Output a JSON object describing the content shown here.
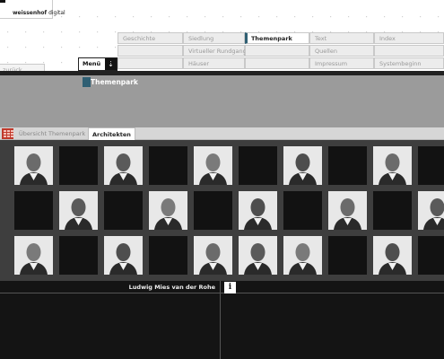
{
  "logo": {
    "prefix": "weissenhof",
    "suffix": " digital"
  },
  "nav": {
    "rows": [
      [
        "Geschichte",
        "Siedlung",
        "Themenpark",
        "Text",
        "Index"
      ],
      [
        "",
        "Virtueller Rundgang",
        "",
        "Quellen",
        ""
      ],
      [
        "",
        "Häuser",
        "",
        "Impressum",
        "Systembeginn"
      ]
    ],
    "active": "Themenpark"
  },
  "back_label": "zurück",
  "menu_label": "Menü",
  "menu_arrow": "⇣",
  "banner_title": "Themenpark",
  "tabs": {
    "overview": "Übersicht Themenpark",
    "current": "Architekten"
  },
  "architect_grid": [
    [
      1,
      0,
      1,
      0,
      1,
      0,
      1,
      0,
      1,
      0
    ],
    [
      0,
      1,
      0,
      1,
      0,
      1,
      0,
      1,
      0,
      1
    ],
    [
      1,
      0,
      1,
      0,
      1,
      1,
      1,
      0,
      1,
      0
    ]
  ],
  "selected_name": "Ludwig Mies van der Rohe",
  "info_label": "i"
}
